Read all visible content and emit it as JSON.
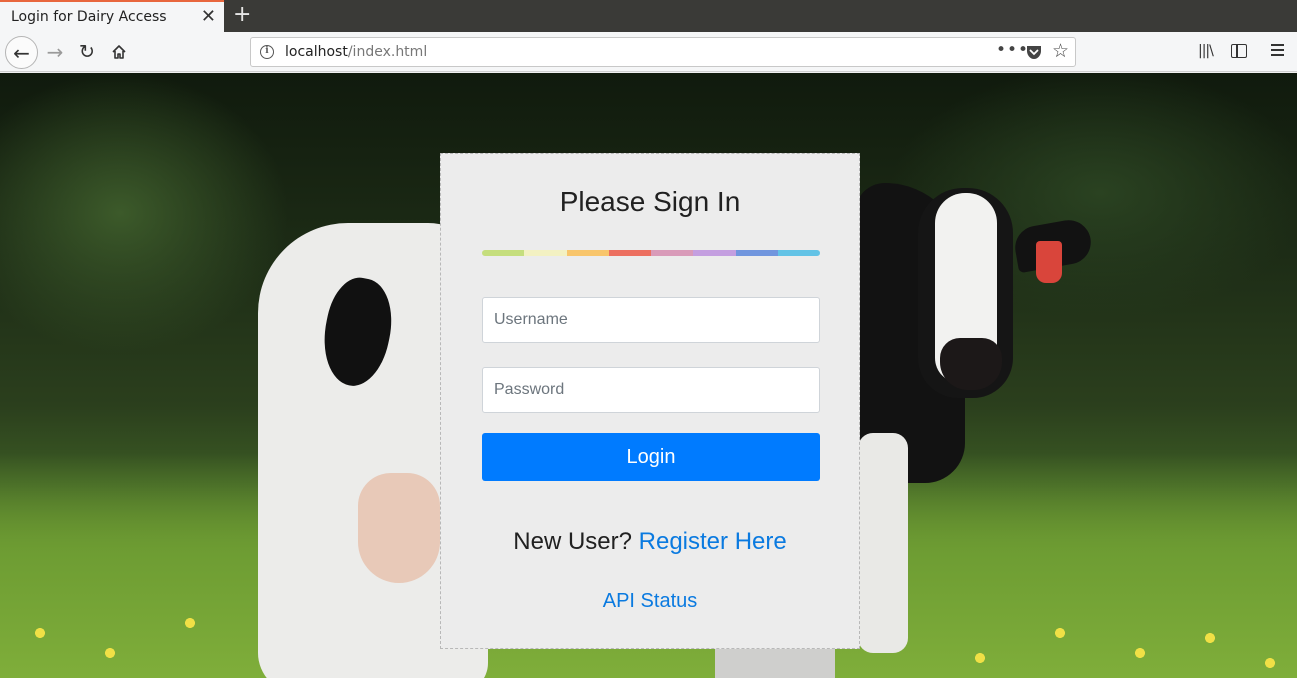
{
  "browser": {
    "tab_title": "Login for Dairy Access",
    "tab_close": "✕",
    "new_tab": "+",
    "url_host": "localhost",
    "url_path": "/index.html",
    "url_more": "•••",
    "back_glyph": "←",
    "forward_glyph": "→",
    "reload_glyph": "↻",
    "star_glyph": "☆",
    "library_glyph": "|||\\",
    "info_glyph": "i"
  },
  "login": {
    "title": "Please Sign In",
    "username_placeholder": "Username",
    "password_placeholder": "Password",
    "login_button": "Login",
    "new_user_text": "New User?",
    "register_link": "Register Here",
    "api_status_link": "API Status"
  },
  "colors": {
    "accent": "#007bff",
    "link": "#0a7ae0",
    "card_bg": "#ececec",
    "rainbow": [
      "#c5de7d",
      "#f3f1c2",
      "#f8c56b",
      "#ec6f60",
      "#d99bb9",
      "#c49fe0",
      "#7196de",
      "#63c3e6"
    ]
  },
  "icons": {
    "back": "arrow-left-icon",
    "forward": "arrow-right-icon",
    "reload": "reload-icon",
    "home": "home-icon",
    "info": "info-icon",
    "pocket": "pocket-icon",
    "bookmark": "star-icon",
    "library": "library-icon",
    "sidebar": "sidebar-icon",
    "menu": "hamburger-menu-icon"
  }
}
